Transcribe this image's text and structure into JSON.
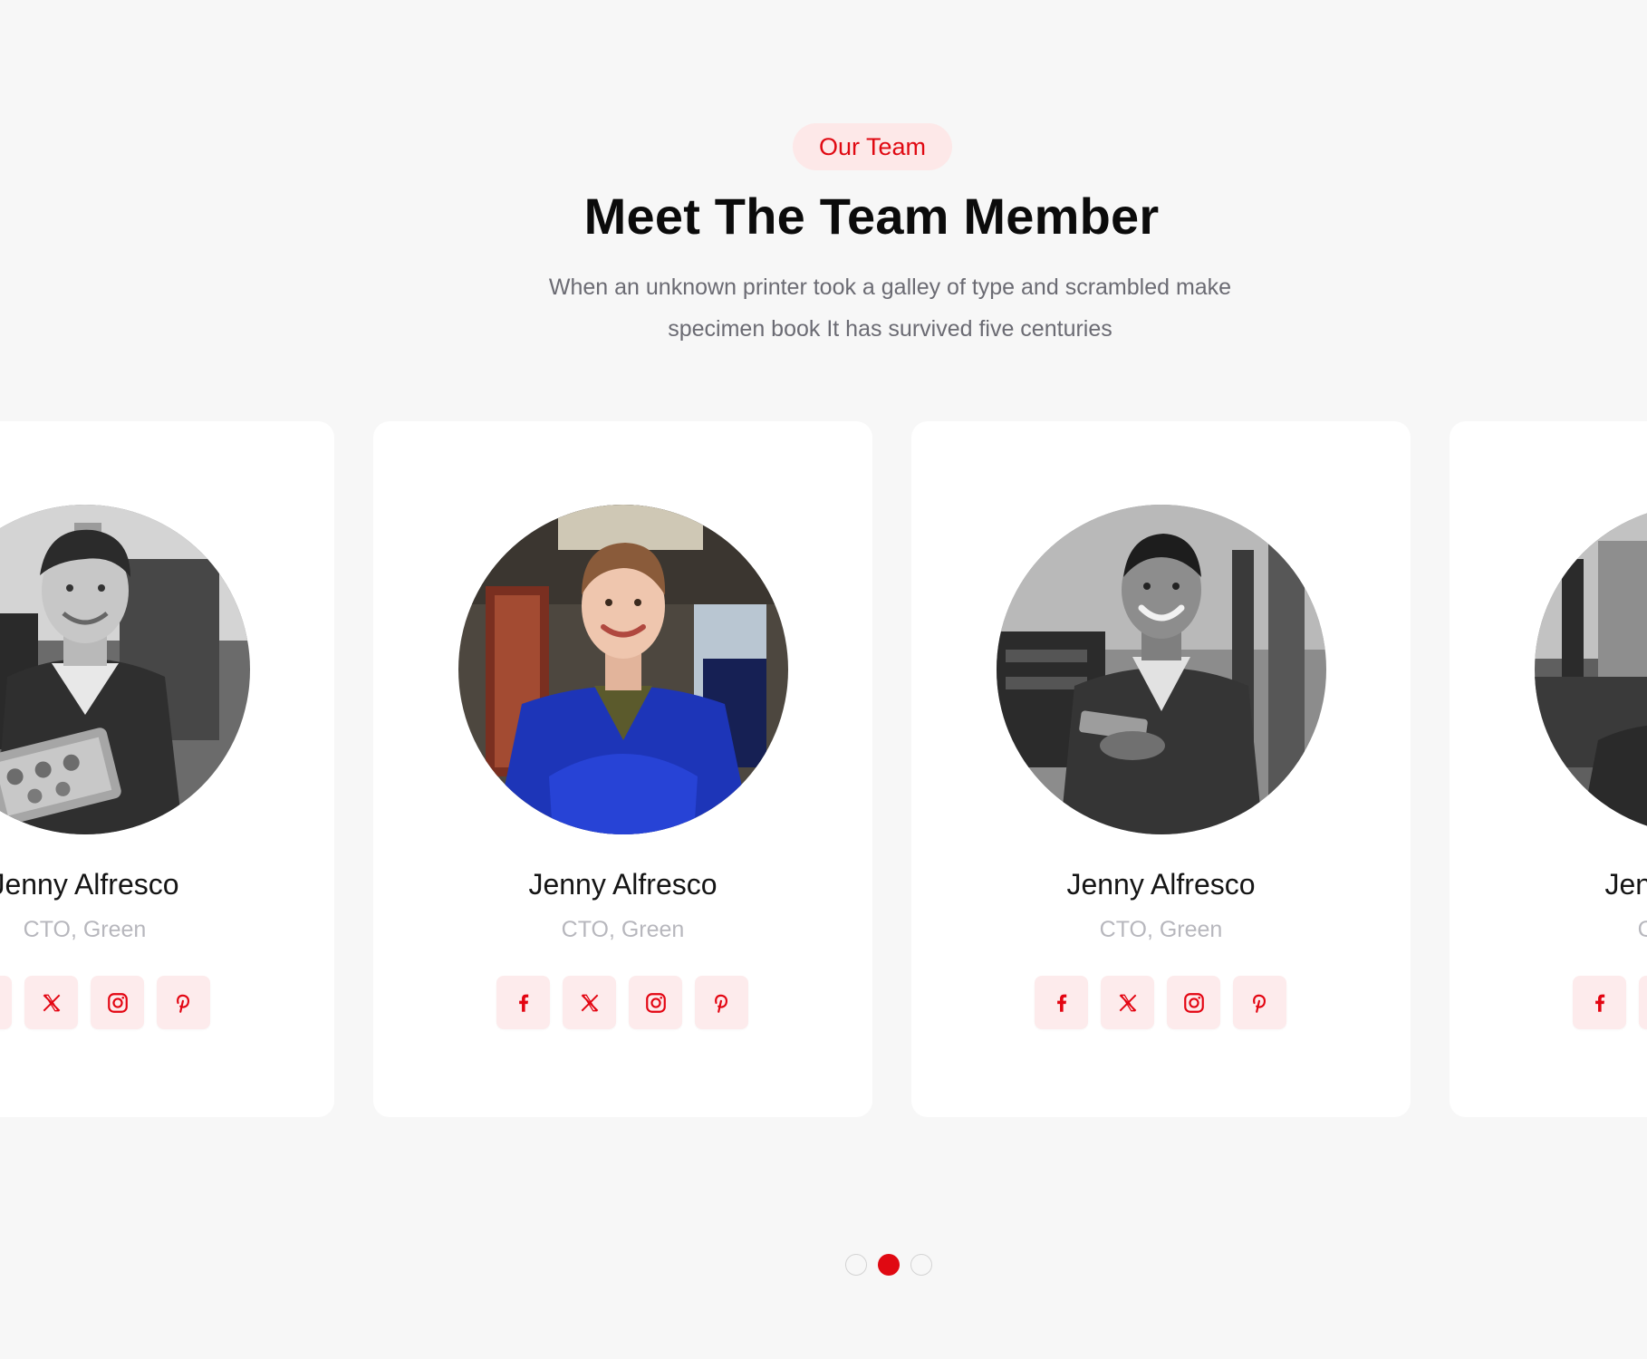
{
  "section": {
    "eyebrow": "Our Team",
    "title": "Meet The Team Member",
    "subtitle_line_1": "When an unknown printer took a galley of type and scrambled make",
    "subtitle_line_2": "specimen book It has survived five centuries"
  },
  "members": [
    {
      "name": "Jenny Alfresco",
      "role": "CTO, Green",
      "photo": "grayscale-mechanic-holding-engine-part"
    },
    {
      "name": "Jenny Alfresco",
      "role": "CTO, Green",
      "photo": "smiling-mechanic-in-blue-coveralls"
    },
    {
      "name": "Jenny Alfresco",
      "role": "CTO, Green",
      "photo": "grayscale-smiling-mechanic-with-tablet"
    },
    {
      "name": "Jenny Alfresco",
      "role": "CTO, Green",
      "photo": "grayscale-mechanic-in-workshop"
    }
  ],
  "socials": [
    "facebook-icon",
    "x-icon",
    "instagram-icon",
    "pinterest-icon"
  ],
  "carousel": {
    "pages": 3,
    "active_page": 2
  },
  "colors": {
    "accent": "#e00912",
    "accent_soft": "#fde8e8",
    "background": "#f7f7f7",
    "card": "#ffffff"
  }
}
